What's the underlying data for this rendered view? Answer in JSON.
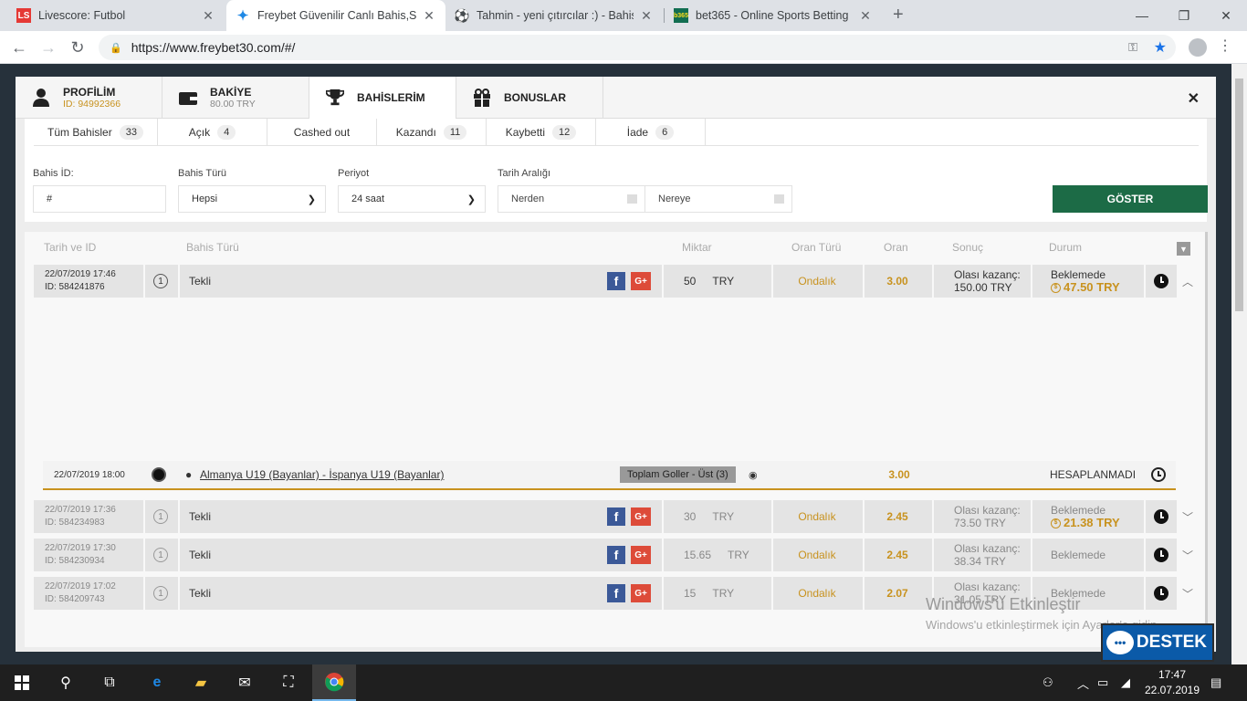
{
  "browser": {
    "tabs": [
      {
        "title": "Livescore: Futbol",
        "icon": "livescore-icon"
      },
      {
        "title": "Freybet Güvenilir Canlı Bahis,Slot",
        "icon": "freybet-icon"
      },
      {
        "title": "Tahmin - yeni çıtırcılar :) - Bahis L",
        "icon": "soccer-ball-icon"
      },
      {
        "title": "bet365 - Online Sports Betting",
        "icon": "bet365-icon"
      }
    ],
    "url": "https://www.freybet30.com/#/"
  },
  "modal": {
    "tabs": {
      "profil": {
        "label": "PROFİLİM",
        "sub": "ID: 94992366"
      },
      "bakiye": {
        "label": "BAKİYE",
        "sub": "80.00 TRY"
      },
      "bahislerim": {
        "label": "BAHİSLERİM"
      },
      "bonuslar": {
        "label": "BONUSLAR"
      }
    }
  },
  "filters": {
    "tabs": [
      {
        "label": "Tüm Bahisler",
        "count": "33"
      },
      {
        "label": "Açık",
        "count": "4"
      },
      {
        "label": "Cashed out",
        "count": ""
      },
      {
        "label": "Kazandı",
        "count": "11"
      },
      {
        "label": "Kaybetti",
        "count": "12"
      },
      {
        "label": "İade",
        "count": "6"
      }
    ],
    "bahis_id_label": "Bahis İD:",
    "bahis_id_placeholder": "#",
    "bahis_turu_label": "Bahis Türü",
    "bahis_turu_value": "Hepsi",
    "periyot_label": "Periyot",
    "periyot_value": "24 saat",
    "tarih_label": "Tarih Aralığı",
    "nerden": "Nerden",
    "nereye": "Nereye",
    "button": "GÖSTER"
  },
  "table": {
    "headers": {
      "tarih": "Tarih ve ID",
      "tur": "Bahis Türü",
      "miktar": "Miktar",
      "oran_turu": "Oran Türü",
      "oran": "Oran",
      "sonuc": "Sonuç",
      "durum": "Durum"
    },
    "rows": [
      {
        "date": "22/07/2019 17:46",
        "id": "ID: 584241876",
        "num": "1",
        "type": "Tekli",
        "amount": "50",
        "currency": "TRY",
        "oran_turu": "Ondalık",
        "oran": "3.00",
        "sonuc_label": "Olası kazanç:",
        "sonuc_value": "150.00 TRY",
        "durum": "Beklemede",
        "win": "47.50 TRY"
      },
      {
        "date": "22/07/2019 17:36",
        "id": "ID: 584234983",
        "num": "1",
        "type": "Tekli",
        "amount": "30",
        "currency": "TRY",
        "oran_turu": "Ondalık",
        "oran": "2.45",
        "sonuc_label": "Olası kazanç:",
        "sonuc_value": "73.50 TRY",
        "durum": "Beklemede",
        "win": "21.38 TRY"
      },
      {
        "date": "22/07/2019 17:30",
        "id": "ID: 584230934",
        "num": "1",
        "type": "Tekli",
        "amount": "15.65",
        "currency": "TRY",
        "oran_turu": "Ondalık",
        "oran": "2.45",
        "sonuc_label": "Olası kazanç:",
        "sonuc_value": "38.34 TRY",
        "durum": "Beklemede",
        "win": ""
      },
      {
        "date": "22/07/2019 17:02",
        "id": "ID: 584209743",
        "num": "1",
        "type": "Tekli",
        "amount": "15",
        "currency": "TRY",
        "oran_turu": "Ondalık",
        "oran": "2.07",
        "sonuc_label": "Olası kazanç:",
        "sonuc_value": "31.05 TRY",
        "durum": "Beklemede",
        "win": ""
      }
    ],
    "detail": {
      "date": "22/07/2019 18:00",
      "match": "Almanya U19 (Bayanlar) - İspanya U19 (Bayanlar)",
      "market": "Toplam Goller - Üst (3)",
      "oran": "3.00",
      "status": "HESAPLANMADI"
    }
  },
  "watermark": {
    "title": "Windows'u Etkinleştir",
    "sub": "Windows'u etkinleştirmek için Ayarlar'a gidin."
  },
  "destek": "DESTEK",
  "taskbar": {
    "time": "17:47",
    "date": "22.07.2019"
  },
  "colors": {
    "gold": "#c8921e",
    "green": "#1c6b46",
    "facebook": "#3b5998",
    "google": "#dd4b39"
  }
}
